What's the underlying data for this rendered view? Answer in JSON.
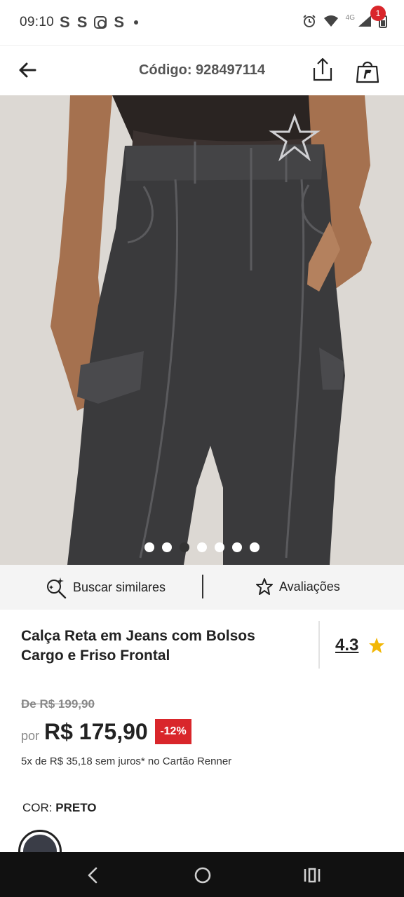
{
  "status": {
    "time": "09:10",
    "notifications": [
      "S",
      "S",
      "instagram-icon",
      "S"
    ],
    "network_label": "4G"
  },
  "header": {
    "title": "Código: 928497114",
    "cart_count": "1"
  },
  "gallery": {
    "image_count": 7,
    "active_index": 2
  },
  "actions": {
    "similar_label": "Buscar similares",
    "reviews_label": "Avaliações"
  },
  "product": {
    "title": "Calça Reta em Jeans com Bolsos Cargo e Friso Frontal",
    "rating": "4.3",
    "old_price": "De R$ 199,90",
    "price_prefix": "por",
    "price": "R$ 175,90",
    "discount": "-12%",
    "installments": "5x de R$ 35,18 sem juros* no Cartão Renner",
    "color_label": "COR:",
    "color_value": "PRETO"
  },
  "colors": {
    "accent": "#d9262b",
    "swatch_black": "#3a3d47"
  }
}
